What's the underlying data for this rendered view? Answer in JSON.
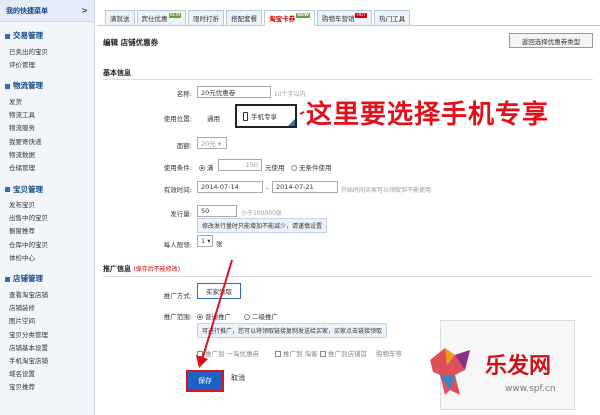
{
  "sidebar": {
    "header": "我的快捷菜单",
    "header_arrow": ">",
    "sections": [
      {
        "title": "交易管理",
        "items": [
          "已卖出的宝贝",
          "评价管理"
        ]
      },
      {
        "title": "物流管理",
        "items": [
          "发货",
          "物流工具",
          "物流服务",
          "我要寄快递",
          "物流数据",
          "仓储管理"
        ]
      },
      {
        "title": "宝贝管理",
        "items": [
          "发布宝贝",
          "出售中的宝贝",
          "橱窗推荐",
          "仓库中的宝贝",
          "体检中心"
        ]
      },
      {
        "title": "店铺管理",
        "items": [
          "查看淘宝店铺",
          "店铺装修",
          "图片空间",
          "宝贝分类管理",
          "店铺基本设置",
          "手机淘宝店铺",
          "域名设置",
          "宝贝推荐"
        ]
      }
    ]
  },
  "tabs": [
    {
      "label": "满就送",
      "active": false,
      "badge": ""
    },
    {
      "label": "宾仕优惠",
      "active": false,
      "badge": "NEW"
    },
    {
      "label": "限时打折",
      "active": false,
      "badge": ""
    },
    {
      "label": "搭配套餐",
      "active": false,
      "badge": ""
    },
    {
      "label": "淘宝卡券",
      "active": true,
      "badge": "NEW"
    },
    {
      "label": "购物车营销",
      "active": false,
      "badge": "HOT"
    },
    {
      "label": "热门工具",
      "active": false,
      "badge": ""
    }
  ],
  "page_title": "编辑 店铺优惠券",
  "reselect_button": "返回选择优惠券类型",
  "basic_info": {
    "heading": "基本信息",
    "name_label": "名称:",
    "name_value": "20元优惠卷",
    "name_hint": "10个字以内",
    "position_label": "使用位置:",
    "position_general": "通用",
    "position_mobile": "手机专享",
    "denomination_label": "面额:",
    "denomination_value": "20元 ▾",
    "condition_label": "使用条件:",
    "condition_full": "满",
    "condition_amount": "150",
    "condition_unit": "元使用",
    "condition_none": "无条件使用",
    "valid_label": "有效时间:",
    "valid_start": "2014-07-14",
    "valid_sep": "-",
    "valid_end": "2014-07-21",
    "valid_hint": "开始时间买家可以领取但不能使用",
    "qty_label": "发行量:",
    "qty_value": "50",
    "qty_hint": "小于100000张",
    "qty_tip": "修改发行量时只能增加不能减少，请谨慎设置",
    "limit_label": "每人限领:",
    "limit_value": "1 ▾",
    "limit_unit": "张"
  },
  "promo_info": {
    "heading": "推广信息",
    "heading_note": "(保存后不能修改)",
    "method_label": "推广方式:",
    "method_value": "买家领取",
    "scope_label": "推广范围:",
    "scope_normal": "普通推广",
    "scope_two": "二级",
    "scope_two_suffix": "推广",
    "scope_tip": "可进行推广，您可以将领取链接复制发送给买家，买家点击链接领取",
    "channels": [
      "推广到 一淘优惠券",
      "推广到 淘客",
      "推广到店铺首",
      "购物车等"
    ]
  },
  "annotation": "这里要选择手机专享",
  "save_label": "保存",
  "cancel_label": "取消",
  "watermark": {
    "text": "乐发网",
    "url": "www.spf.cn"
  },
  "colors": {
    "accent": "#1b62c4",
    "annotation": "#e0101d",
    "sidebar_title": "#14498a"
  }
}
